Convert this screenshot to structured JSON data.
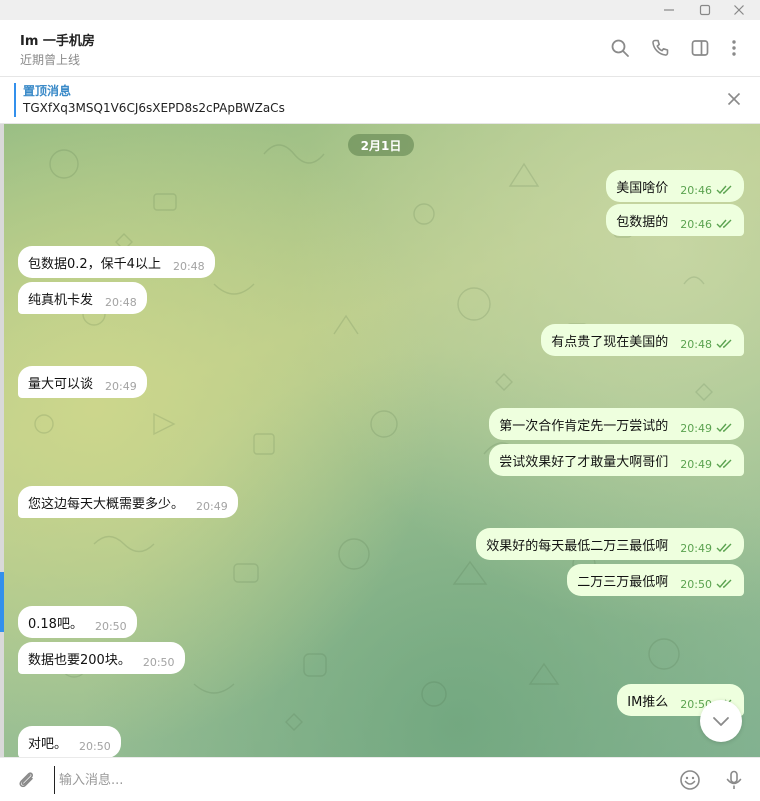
{
  "header": {
    "title": "Im 一手机房",
    "status": "近期曾上线"
  },
  "pinned": {
    "label": "置顶消息",
    "text": "TGXfXq3MSQ1V6CJ6sXEPD8s2cPApBWZaCs"
  },
  "chat": {
    "date": "2月1日",
    "messages": [
      {
        "text": "美国啥价",
        "time": "20:46",
        "dir": "out"
      },
      {
        "text": "包数据的",
        "time": "20:46",
        "dir": "out"
      },
      {
        "text": "包数据0.2，保千4以上",
        "time": "20:48",
        "dir": "in"
      },
      {
        "text": "纯真机卡发",
        "time": "20:48",
        "dir": "in"
      },
      {
        "text": "有点贵了现在美国的",
        "time": "20:48",
        "dir": "out"
      },
      {
        "text": "量大可以谈",
        "time": "20:49",
        "dir": "in"
      },
      {
        "text": "第一次合作肯定先一万尝试的",
        "time": "20:49",
        "dir": "out"
      },
      {
        "text": "尝试效果好了才敢量大啊哥们",
        "time": "20:49",
        "dir": "out"
      },
      {
        "text": "您这边每天大概需要多少。",
        "time": "20:49",
        "dir": "in"
      },
      {
        "text": "效果好的每天最低二万三最低啊",
        "time": "20:49",
        "dir": "out"
      },
      {
        "text": "二万三万最低啊",
        "time": "20:50",
        "dir": "out"
      },
      {
        "text": "0.18吧。",
        "time": "20:50",
        "dir": "in"
      },
      {
        "text": "数据也要200块。",
        "time": "20:50",
        "dir": "in"
      },
      {
        "text": "IM推么",
        "time": "20:50",
        "dir": "out"
      },
      {
        "text": "对吧。",
        "time": "20:50",
        "dir": "in"
      }
    ]
  },
  "composer": {
    "placeholder": "输入消息..."
  },
  "colors": {
    "accent": "#3390ec",
    "outgoing_bubble": "#eeffde",
    "incoming_bubble": "#ffffff",
    "read_tick": "#5ba350"
  }
}
